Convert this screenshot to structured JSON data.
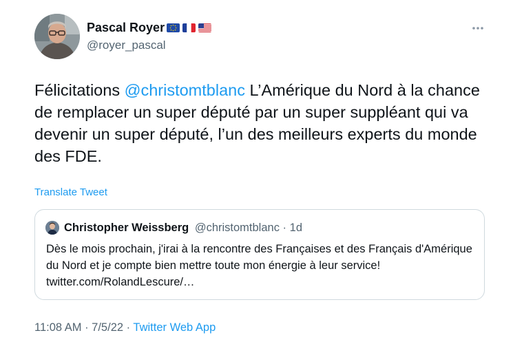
{
  "author": {
    "name": "Pascal Royer",
    "handle": "@royer_pascal",
    "flags": [
      "eu-flag-icon",
      "france-flag-icon",
      "usa-flag-icon"
    ]
  },
  "tweet": {
    "text_before": "Félicitations ",
    "mention": "@christomtblanc",
    "text_after": " L’Amérique du Nord à la chance de remplacer un super député par un super suppléant qui va devenir un super député, l’un des meilleurs experts du monde des FDE."
  },
  "translate_label": "Translate Tweet",
  "quoted": {
    "name": "Christopher Weissberg",
    "handle": "@christomtblanc",
    "separator": "·",
    "time": "1d",
    "text": "Dès le mois prochain, j'irai à la rencontre des Françaises et des Français d'Amérique du Nord et je compte bien mettre toute mon énergie à leur service! twitter.com/RolandLescure/…"
  },
  "meta": {
    "time": "11:08 AM",
    "separator": " · ",
    "date": "7/5/22",
    "source": "Twitter Web App"
  },
  "colors": {
    "accent": "#1d9bf0",
    "text": "#0f1419",
    "secondary": "#536471",
    "border": "#cfd9de"
  }
}
